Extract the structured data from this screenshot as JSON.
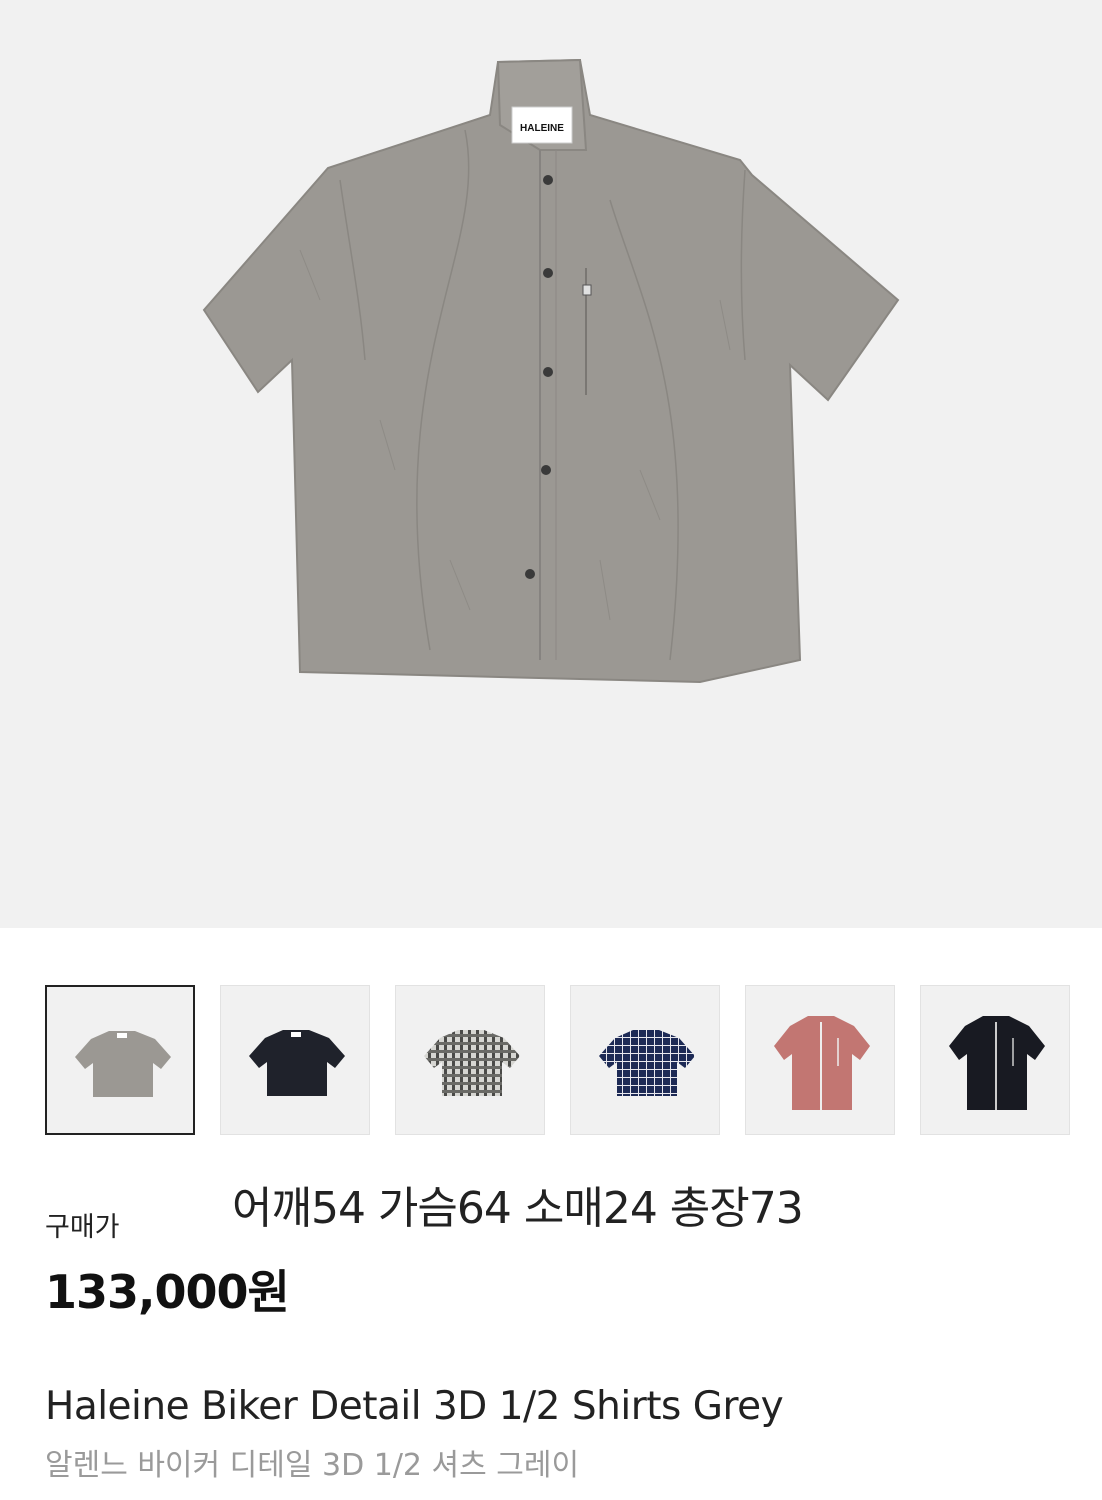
{
  "product": {
    "brand_label": "HALEINE",
    "sizes": "어깨54 가슴64 소매24 총장73",
    "price_label": "구매가",
    "price": "133,000원",
    "name_en": "Haleine Biker Detail 3D 1/2 Shirts Grey",
    "name_ko": "알렌느 바이커 디테일 3D 1/2 셔츠 그레이"
  },
  "thumbnails": [
    {
      "color": "#9b9893",
      "style": "plain",
      "selected": true
    },
    {
      "color": "#1f222b",
      "style": "plain",
      "selected": false
    },
    {
      "color": "#8a8a86",
      "style": "check-grey",
      "selected": false
    },
    {
      "color": "#1d2a55",
      "style": "check-navy",
      "selected": false
    },
    {
      "color": "#c27672",
      "style": "zip",
      "selected": false
    },
    {
      "color": "#181a22",
      "style": "zip",
      "selected": false
    }
  ],
  "colors": {
    "hero_bg": "#f1f1f1",
    "shirt_grey": "#9b9893",
    "text_primary": "#222222",
    "text_secondary": "#9a9a9a"
  }
}
